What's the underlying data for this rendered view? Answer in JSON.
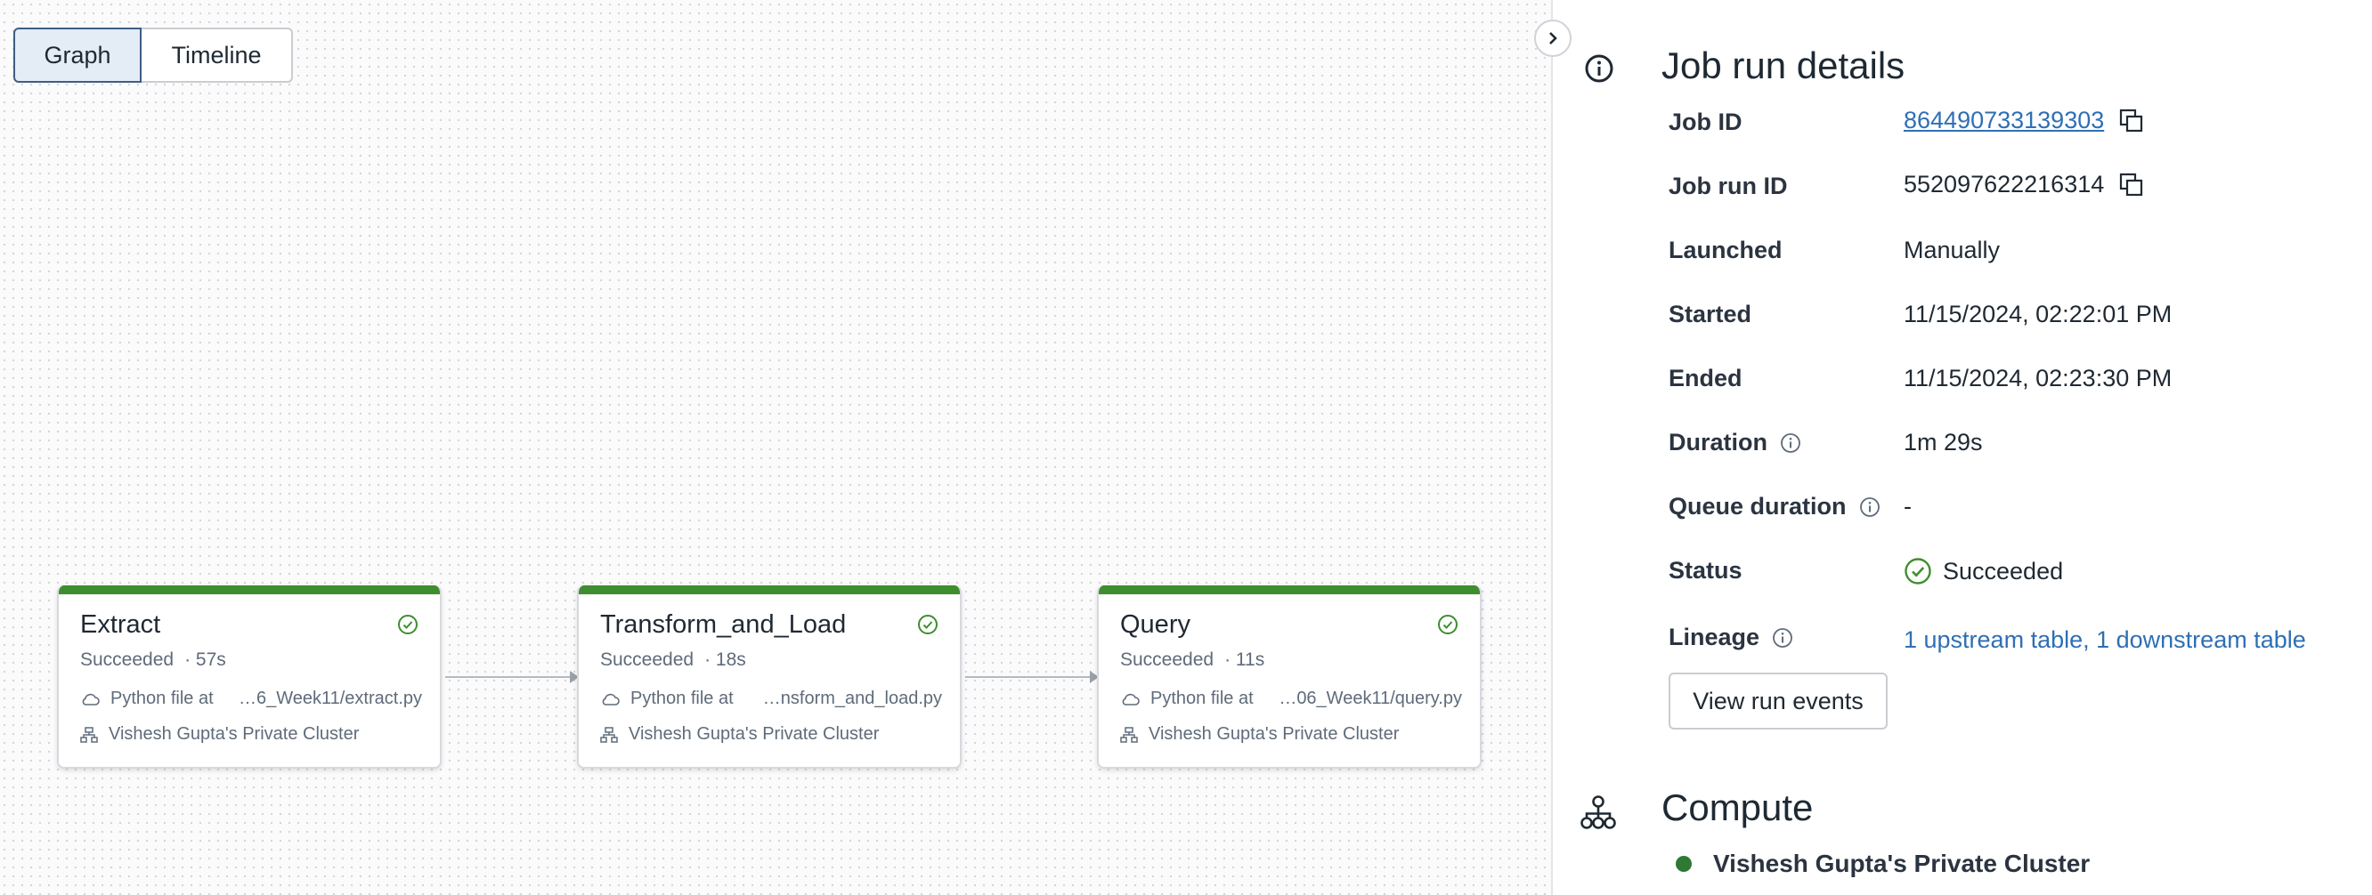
{
  "view_toggle": {
    "graph_label": "Graph",
    "timeline_label": "Timeline",
    "selected": "Graph"
  },
  "tasks": [
    {
      "name": "Extract",
      "status": "Succeeded",
      "duration": "· 57s",
      "file_label": "Python file at",
      "file_path": "…6_Week11/extract.py",
      "cluster": "Vishesh Gupta's Private Cluster"
    },
    {
      "name": "Transform_and_Load",
      "status": "Succeeded",
      "duration": "· 18s",
      "file_label": "Python file at",
      "file_path": "…nsform_and_load.py",
      "cluster": "Vishesh Gupta's Private Cluster"
    },
    {
      "name": "Query",
      "status": "Succeeded",
      "duration": "· 11s",
      "file_label": "Python file at",
      "file_path": "…06_Week11/query.py",
      "cluster": "Vishesh Gupta's Private Cluster"
    }
  ],
  "details": {
    "title": "Job run details",
    "job_id_label": "Job ID",
    "job_id": "864490733139303",
    "job_run_id_label": "Job run ID",
    "job_run_id": "552097622216314",
    "launched_label": "Launched",
    "launched": "Manually",
    "started_label": "Started",
    "started": "11/15/2024, 02:22:01 PM",
    "ended_label": "Ended",
    "ended": "11/15/2024, 02:23:30 PM",
    "duration_label": "Duration",
    "duration": "1m 29s",
    "queue_duration_label": "Queue duration",
    "queue_duration": "-",
    "status_label": "Status",
    "status": "Succeeded",
    "lineage_label": "Lineage",
    "lineage": "1 upstream table, 1 downstream table",
    "view_run_events_label": "View run events"
  },
  "compute": {
    "title": "Compute",
    "cluster_name": "Vishesh Gupta's Private Cluster"
  },
  "colors": {
    "success": "#3e8e2f",
    "link": "#2e6fb5",
    "selected_toggle": "#e4ecf6"
  },
  "icons": [
    "info-circle-icon",
    "copy-icon",
    "check-circle-icon",
    "cloud-icon",
    "cluster-icon",
    "compute-icon",
    "chevron-right-icon"
  ]
}
